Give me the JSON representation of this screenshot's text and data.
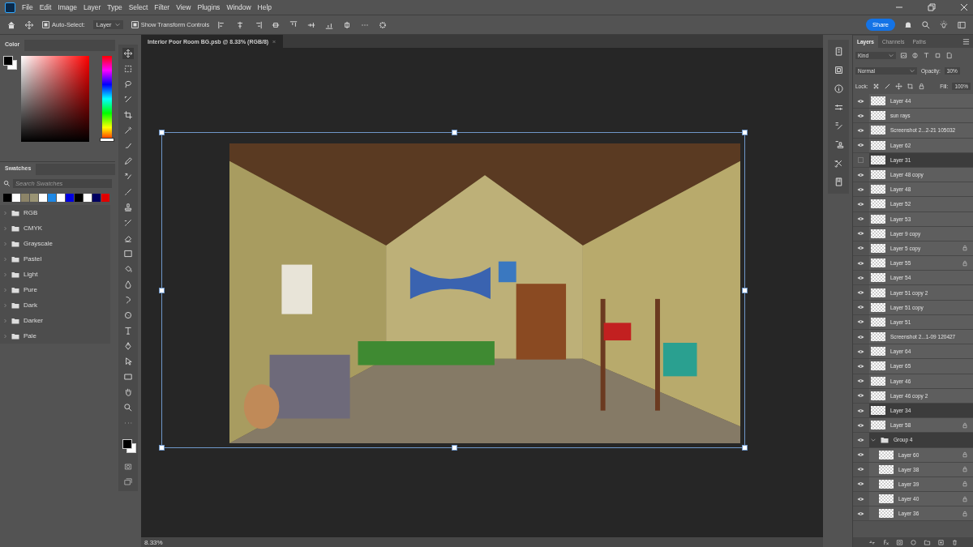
{
  "menu": [
    "File",
    "Edit",
    "Image",
    "Layer",
    "Type",
    "Select",
    "Filter",
    "View",
    "Plugins",
    "Window",
    "Help"
  ],
  "options_bar": {
    "auto_select": {
      "label": "Auto-Select:",
      "checked": true,
      "value": "Layer"
    },
    "show_transform": {
      "label": "Show Transform Controls",
      "checked": true
    },
    "share": "Share"
  },
  "document_tab": {
    "title": "Interior Poor Room BG.psb @ 8.33% (RGB/8)"
  },
  "color_panel": {
    "title": "Color",
    "hue_slider": {
      "level": 0
    }
  },
  "swatches_panel": {
    "title": "Swatches",
    "search": {
      "placeholder": "Search Swatches"
    },
    "colors": [
      {
        "color": "#000000"
      },
      {
        "color": "#ffffff"
      },
      {
        "color": "#8c8468"
      },
      {
        "color": "#9a9474"
      },
      {
        "color": "#ffffff"
      },
      {
        "color": "#1e88e5"
      },
      {
        "color": "#ffffff"
      },
      {
        "color": "#0000e0"
      },
      {
        "color": "#000000"
      },
      {
        "color": "#ffffff"
      },
      {
        "color": "#000060"
      },
      {
        "color": "#e00000"
      }
    ],
    "folders": [
      "RGB",
      "CMYK",
      "Grayscale",
      "Pastel",
      "Light",
      "Pure",
      "Dark",
      "Darker",
      "Pale"
    ]
  },
  "layers_panel": {
    "tabs": [
      {
        "label": "Layers",
        "selected": true
      },
      {
        "label": "Channels",
        "selected": false
      },
      {
        "label": "Paths",
        "selected": false
      }
    ],
    "filter": "Kind",
    "blend_mode": "Normal",
    "opacity": {
      "label": "Opacity:",
      "value": "30%"
    },
    "lock_label": "Lock:",
    "fill": {
      "label": "Fill:",
      "value": "100%"
    },
    "layers": [
      {
        "name": "Layer 44",
        "visible": true,
        "locked": false,
        "selected": false
      },
      {
        "name": "sun rays",
        "visible": true,
        "locked": false,
        "selected": false
      },
      {
        "name": "Screenshot 2...2-21 105032",
        "visible": true,
        "locked": false,
        "selected": false
      },
      {
        "name": "Layer 62",
        "visible": true,
        "locked": false,
        "selected": false
      },
      {
        "name": "Layer 31",
        "visible": false,
        "locked": false,
        "selected": true
      },
      {
        "name": "Layer 48 copy",
        "visible": true,
        "locked": false,
        "selected": false
      },
      {
        "name": "Layer 48",
        "visible": true,
        "locked": false,
        "selected": false
      },
      {
        "name": "Layer 52",
        "visible": true,
        "locked": false,
        "selected": false
      },
      {
        "name": "Layer 53",
        "visible": true,
        "locked": false,
        "selected": false
      },
      {
        "name": "Layer 9 copy",
        "visible": true,
        "locked": false,
        "selected": false
      },
      {
        "name": "Layer 5 copy",
        "visible": true,
        "locked": true,
        "selected": false
      },
      {
        "name": "Layer 55",
        "visible": true,
        "locked": true,
        "selected": false
      },
      {
        "name": "Layer 54",
        "visible": true,
        "locked": false,
        "selected": false
      },
      {
        "name": "Layer 51 copy 2",
        "visible": true,
        "locked": false,
        "selected": false
      },
      {
        "name": "Layer 51 copy",
        "visible": true,
        "locked": false,
        "selected": false
      },
      {
        "name": "Layer 51",
        "visible": true,
        "locked": false,
        "selected": false
      },
      {
        "name": "Screenshot 2...1-09 120427",
        "visible": true,
        "locked": false,
        "selected": false
      },
      {
        "name": "Layer 64",
        "visible": true,
        "locked": false,
        "selected": false
      },
      {
        "name": "Layer 65",
        "visible": true,
        "locked": false,
        "selected": false
      },
      {
        "name": "Layer 46",
        "visible": true,
        "locked": false,
        "selected": false
      },
      {
        "name": "Layer 46 copy 2",
        "visible": true,
        "locked": false,
        "selected": false
      },
      {
        "name": "Layer 34",
        "visible": true,
        "locked": false,
        "selected": true
      },
      {
        "name": "Layer 58",
        "visible": true,
        "locked": true,
        "selected": false
      },
      {
        "name": "Group 4",
        "visible": true,
        "locked": false,
        "selected": true,
        "expanded": true,
        "children": [
          {
            "name": "Layer 60",
            "visible": true,
            "locked": true,
            "selected": false
          },
          {
            "name": "Layer 38",
            "visible": true,
            "locked": true,
            "selected": false
          },
          {
            "name": "Layer 39",
            "visible": true,
            "locked": true,
            "selected": false
          },
          {
            "name": "Layer 40",
            "visible": true,
            "locked": true,
            "selected": false
          },
          {
            "name": "Layer 36",
            "visible": true,
            "locked": true,
            "selected": false
          }
        ]
      }
    ]
  },
  "status_bar": {
    "zoom": "8.33%"
  }
}
